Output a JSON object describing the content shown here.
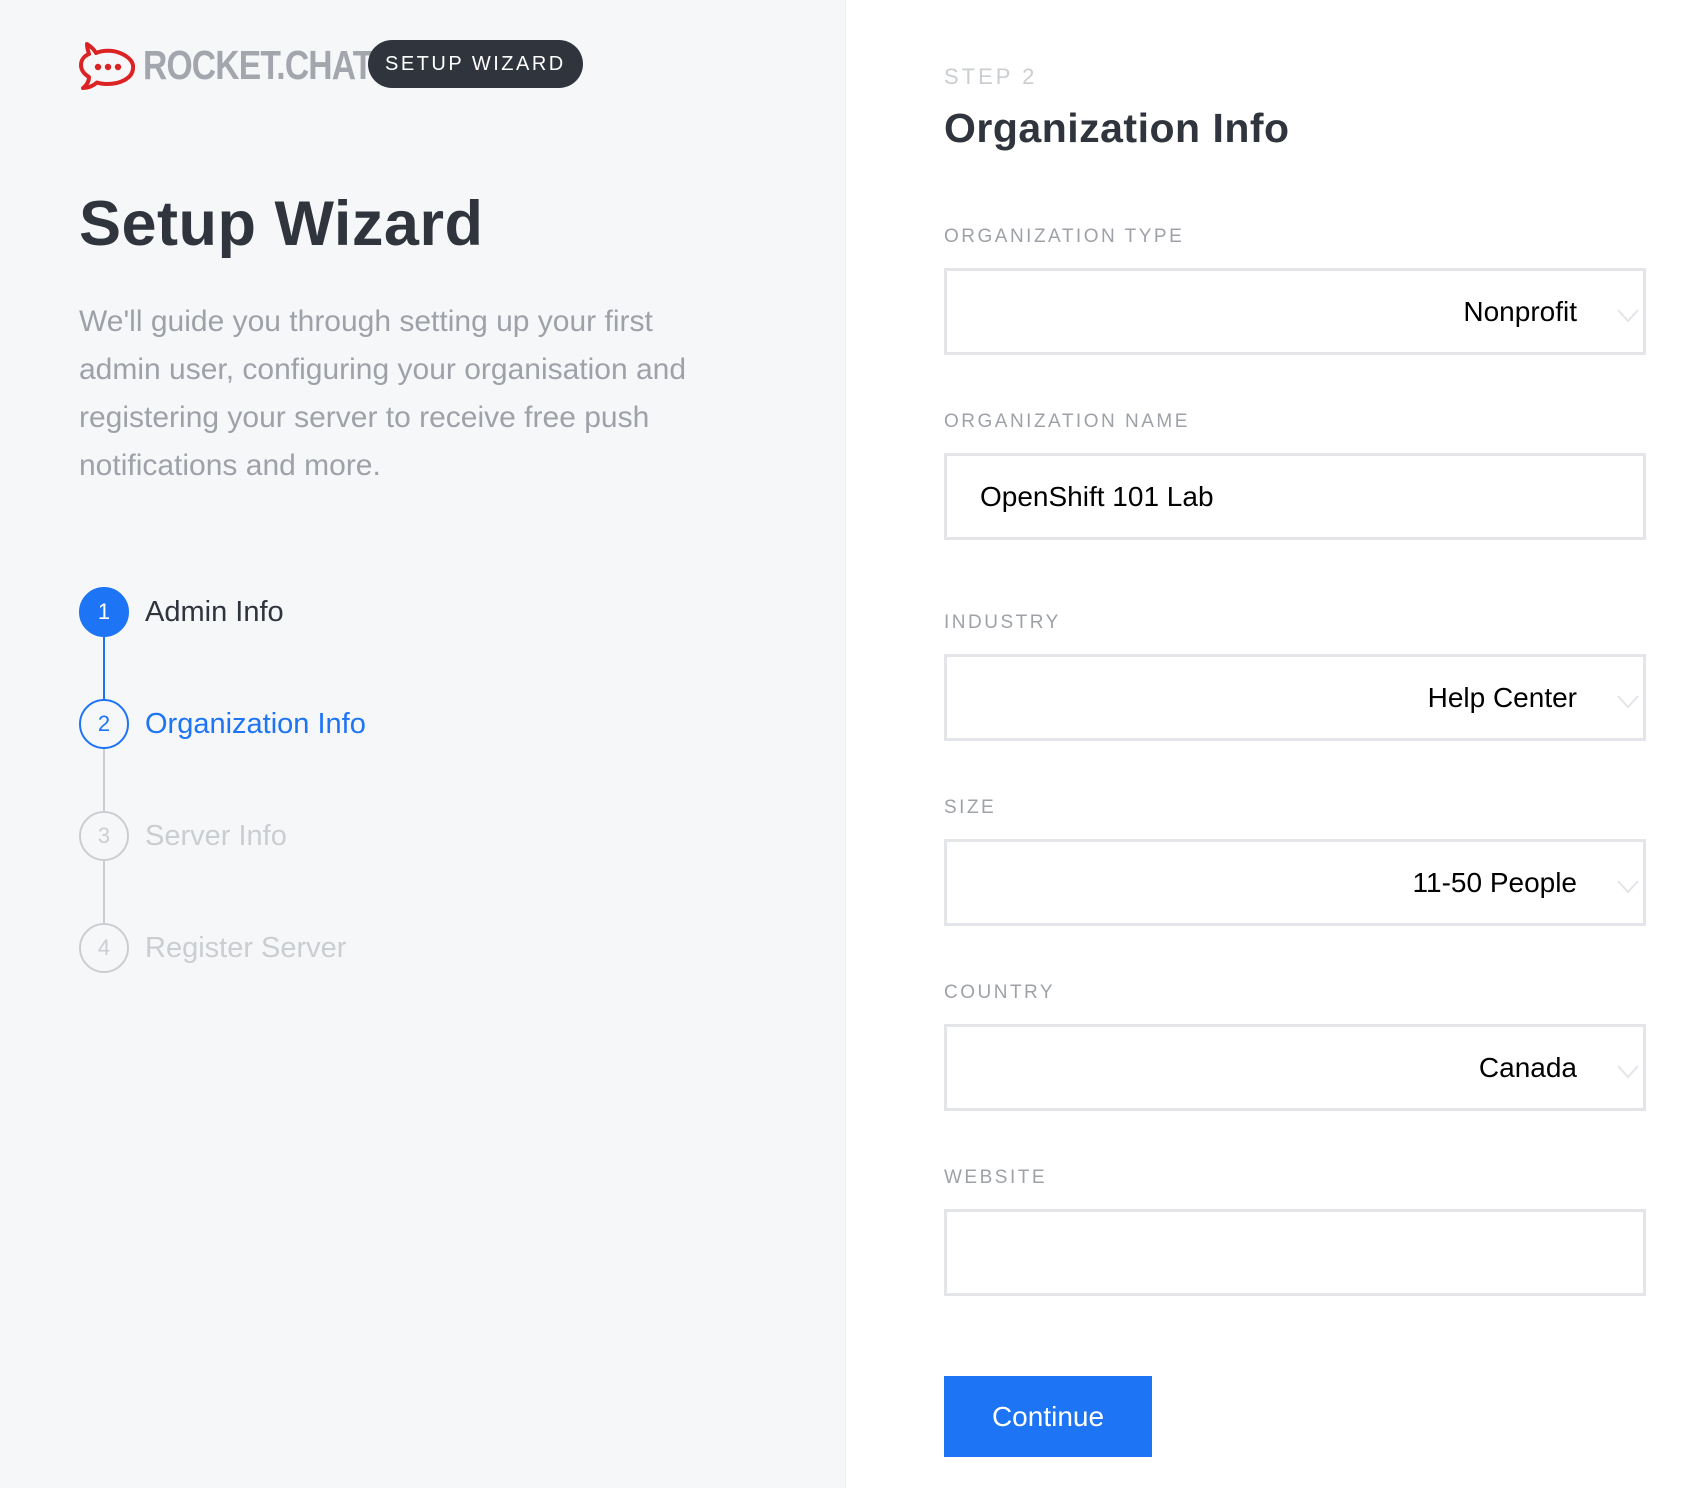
{
  "brand": {
    "logo_text": "ROCKET.CHAT",
    "badge": "SETUP WIZARD",
    "logo_color": "#db2323"
  },
  "intro": {
    "title": "Setup Wizard",
    "description": "We'll guide you through setting up your first admin user, configuring your organisation and registering your server to receive free push notifications and more."
  },
  "steps": [
    {
      "number": "1",
      "label": "Admin Info",
      "state": "done"
    },
    {
      "number": "2",
      "label": "Organization Info",
      "state": "active"
    },
    {
      "number": "3",
      "label": "Server Info",
      "state": "todo"
    },
    {
      "number": "4",
      "label": "Register Server",
      "state": "todo"
    }
  ],
  "form": {
    "step": "STEP 2",
    "title": "Organization Info",
    "fields": {
      "organization_type": {
        "label": "ORGANIZATION TYPE",
        "value": "Nonprofit"
      },
      "organization_name": {
        "label": "ORGANIZATION NAME",
        "value": "OpenShift 101 Lab"
      },
      "industry": {
        "label": "INDUSTRY",
        "value": "Help Center"
      },
      "size": {
        "label": "SIZE",
        "value": "11-50 People"
      },
      "country": {
        "label": "COUNTRY",
        "value": "Canada"
      },
      "website": {
        "label": "WEBSITE",
        "value": ""
      }
    },
    "continue_label": "Continue"
  },
  "colors": {
    "accent": "#1d74f5",
    "dark": "#2f343d",
    "muted": "#9ea2a8",
    "disabled": "#cbced1",
    "left_background": "#f6f7f9"
  }
}
